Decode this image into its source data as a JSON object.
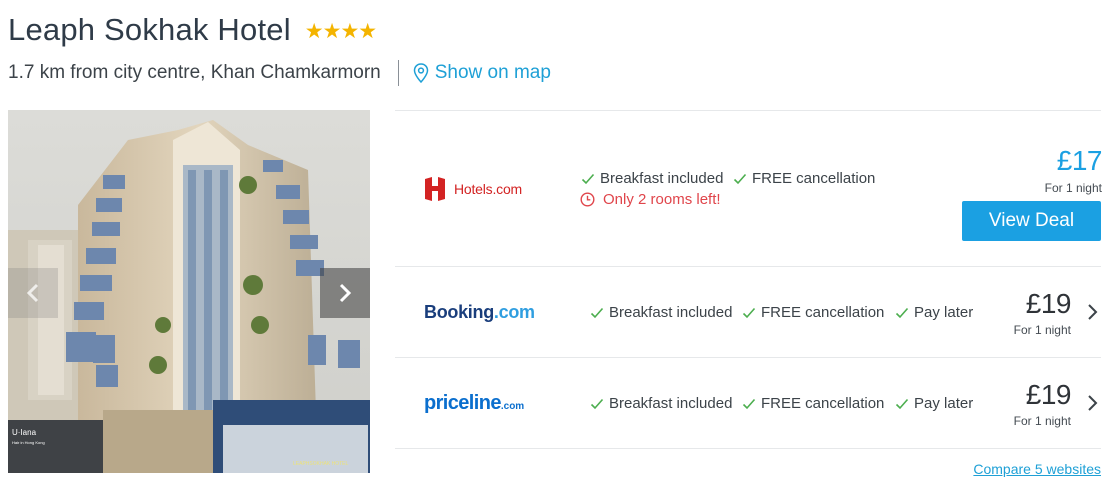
{
  "hotel": {
    "name": "Leaph Sokhak Hotel",
    "star_rating": 4,
    "stars_text": "★★★★",
    "location": "1.7 km from city centre, Khan Chamkarmorn",
    "map_link": "Show on map"
  },
  "photo": {
    "signage_left": "U·Iana",
    "signage_left_sub": "Hair in Hong Kong",
    "signage_right": "LEAPHSOKHAK HOTEL"
  },
  "deals": [
    {
      "provider": "Hotels.com",
      "features": [
        "Breakfast included",
        "FREE cancellation"
      ],
      "urgency": "Only 2 rooms left!",
      "price": "£17",
      "price_sub": "For 1 night",
      "cta": "View Deal",
      "price_color": "#1ba0e2"
    },
    {
      "provider_main": "Booking",
      "provider_tld": ".com",
      "features": [
        "Breakfast included",
        "FREE cancellation",
        "Pay later"
      ],
      "price": "£19",
      "price_sub": "For 1 night"
    },
    {
      "provider_main": "priceline",
      "provider_tld": ".com",
      "features": [
        "Breakfast included",
        "FREE cancellation",
        "Pay later"
      ],
      "price": "£19",
      "price_sub": "For 1 night"
    }
  ],
  "compare_link": "Compare 5 websites",
  "colors": {
    "accent": "#1ba0e2",
    "link": "#1ea0d6",
    "check": "#4cae4f",
    "urgency": "#e0454b",
    "star": "#f4b400",
    "hotels_red": "#d32323",
    "booking_navy": "#1a3e7c",
    "booking_blue": "#2f9ee0",
    "priceline_blue": "#0b6fce"
  }
}
